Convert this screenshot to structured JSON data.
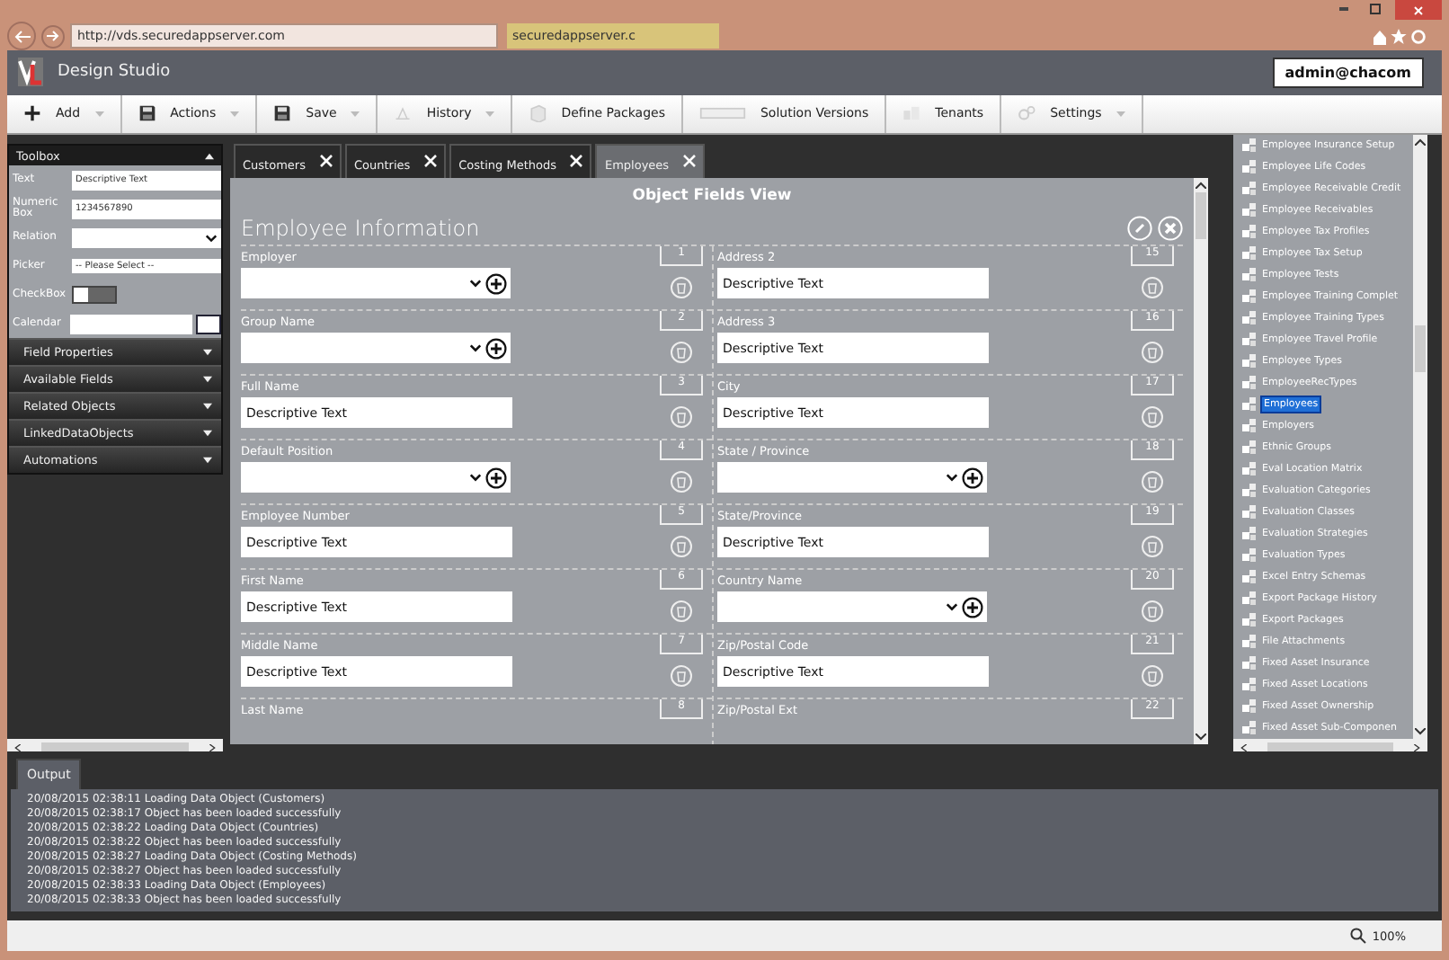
{
  "browser": {
    "url": "http://vds.securedappserver.com",
    "tab_title": "securedappserver.c"
  },
  "app": {
    "title": "Design Studio",
    "user": "admin@chacom"
  },
  "toolbar": [
    {
      "label": "Add",
      "kind": "plus",
      "menu": true
    },
    {
      "label": "Actions",
      "kind": "disk",
      "menu": true
    },
    {
      "label": "Save",
      "kind": "disk",
      "menu": true
    },
    {
      "label": "History",
      "kind": "history",
      "menu": true
    },
    {
      "label": "Define Packages",
      "kind": "package",
      "menu": false
    },
    {
      "label": "Solution Versions",
      "kind": "versions",
      "menu": false
    },
    {
      "label": "Tenants",
      "kind": "tenants",
      "menu": false
    },
    {
      "label": "Settings",
      "kind": "gear",
      "menu": true
    }
  ],
  "toolbox": {
    "title": "Toolbox",
    "expanded": true,
    "controls": [
      {
        "kind": "text",
        "label": "Text",
        "value": "Descriptive Text"
      },
      {
        "kind": "text",
        "label": "Numeric Box",
        "value": "1234567890"
      },
      {
        "kind": "select",
        "label": "Relation"
      },
      {
        "kind": "picker",
        "label": "Picker",
        "value": "-- Please Select --"
      },
      {
        "kind": "toggle",
        "label": "CheckBox",
        "on": false
      },
      {
        "kind": "date",
        "label": "Calendar"
      }
    ],
    "sections": [
      {
        "label": "Field Properties",
        "expanded": false
      },
      {
        "label": "Available Fields",
        "expanded": false
      },
      {
        "label": "Related Objects",
        "expanded": false
      },
      {
        "label": "LinkedDataObjects",
        "expanded": false
      },
      {
        "label": "Automations",
        "expanded": false
      }
    ]
  },
  "tabs": [
    {
      "label": "Customers",
      "selected": false
    },
    {
      "label": "Countries",
      "selected": false
    },
    {
      "label": "Costing Methods",
      "selected": false
    },
    {
      "label": "Employees",
      "selected": true
    }
  ],
  "form": {
    "title": "Object Fields View",
    "section": "Employee Information",
    "left": [
      {
        "label": "Employer",
        "kind": "dropdown",
        "number": "1"
      },
      {
        "label": "Group Name",
        "kind": "dropdown",
        "number": "2"
      },
      {
        "label": "Full Name",
        "kind": "text",
        "value": "Descriptive Text",
        "number": "3"
      },
      {
        "label": "Default Position",
        "kind": "dropdown",
        "number": "4"
      },
      {
        "label": "Employee Number",
        "kind": "text",
        "value": "Descriptive Text",
        "number": "5"
      },
      {
        "label": "First Name",
        "kind": "text",
        "value": "Descriptive Text",
        "number": "6"
      },
      {
        "label": "Middle Name",
        "kind": "text",
        "value": "Descriptive Text",
        "number": "7"
      },
      {
        "label": "Last Name",
        "kind": "partial",
        "number": "8"
      }
    ],
    "right": [
      {
        "label": "Address 2",
        "kind": "text",
        "value": "Descriptive Text",
        "number": "15"
      },
      {
        "label": "Address 3",
        "kind": "text",
        "value": "Descriptive Text",
        "number": "16"
      },
      {
        "label": "City",
        "kind": "text",
        "value": "Descriptive Text",
        "number": "17"
      },
      {
        "label": "State / Province",
        "kind": "dropdown",
        "number": "18"
      },
      {
        "label": "State/Province",
        "kind": "text",
        "value": "Descriptive Text",
        "number": "19"
      },
      {
        "label": "Country Name",
        "kind": "dropdown",
        "number": "20"
      },
      {
        "label": "Zip/Postal Code",
        "kind": "text",
        "value": "Descriptive Text",
        "number": "21"
      },
      {
        "label": "Zip/Postal Ext",
        "kind": "partial",
        "number": "22"
      }
    ]
  },
  "tree": [
    {
      "label": "Employee Insurance Setup",
      "selected": false
    },
    {
      "label": "Employee Life Codes",
      "selected": false
    },
    {
      "label": "Employee Receivable Credit",
      "selected": false
    },
    {
      "label": "Employee Receivables",
      "selected": false
    },
    {
      "label": "Employee Tax Profiles",
      "selected": false
    },
    {
      "label": "Employee Tax Setup",
      "selected": false
    },
    {
      "label": "Employee Tests",
      "selected": false
    },
    {
      "label": "Employee Training Complet",
      "selected": false
    },
    {
      "label": "Employee Training Types",
      "selected": false
    },
    {
      "label": "Employee Travel Profile",
      "selected": false
    },
    {
      "label": "Employee Types",
      "selected": false
    },
    {
      "label": "EmployeeRecTypes",
      "selected": false
    },
    {
      "label": "Employees",
      "selected": true
    },
    {
      "label": "Employers",
      "selected": false
    },
    {
      "label": "Ethnic Groups",
      "selected": false
    },
    {
      "label": "Eval Location Matrix",
      "selected": false
    },
    {
      "label": "Evaluation Categories",
      "selected": false
    },
    {
      "label": "Evaluation Classes",
      "selected": false
    },
    {
      "label": "Evaluation Strategies",
      "selected": false
    },
    {
      "label": "Evaluation Types",
      "selected": false
    },
    {
      "label": "Excel Entry Schemas",
      "selected": false
    },
    {
      "label": "Export Package History",
      "selected": false
    },
    {
      "label": "Export Packages",
      "selected": false
    },
    {
      "label": "File Attachments",
      "selected": false
    },
    {
      "label": "Fixed Asset Insurance",
      "selected": false
    },
    {
      "label": "Fixed Asset Locations",
      "selected": false
    },
    {
      "label": "Fixed Asset Ownership",
      "selected": false
    },
    {
      "label": "Fixed Asset Sub-Componen",
      "selected": false
    }
  ],
  "output": {
    "tab": "Output",
    "lines": [
      "20/08/2015 02:38:11 Loading Data Object (Customers)",
      "20/08/2015 02:38:17 Object has been loaded successfully",
      "20/08/2015 02:38:22 Loading Data Object (Countries)",
      "20/08/2015 02:38:22 Object has been loaded successfully",
      "20/08/2015 02:38:27 Loading Data Object (Costing Methods)",
      "20/08/2015 02:38:27 Object has been loaded successfully",
      "20/08/2015 02:38:33 Loading Data Object (Employees)",
      "20/08/2015 02:38:33 Object has been loaded successfully"
    ]
  },
  "status": {
    "zoom": "100%"
  }
}
